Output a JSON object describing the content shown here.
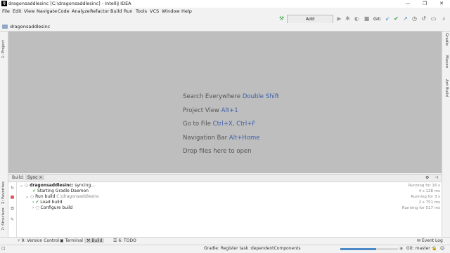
{
  "window": {
    "title": "dragonsaddlesinc [C:\\dragonsaddlesinc] - IntelliJ IDEA",
    "app_icon": "IJ",
    "controls": [
      "—",
      "❐",
      "✕"
    ]
  },
  "menu": [
    "File",
    "Edit",
    "View",
    "Navigate",
    "Code",
    "Analyze",
    "Refactor",
    "Build",
    "Run",
    "Tools",
    "VCS",
    "Window",
    "Help"
  ],
  "toolbar": {
    "add_config_label": "Add Configuration...",
    "git_label": "Git:"
  },
  "nav": {
    "crumb": "dragonsaddlesinc"
  },
  "left_tool_windows": [
    "1: Project",
    "2: Favorites",
    "7: Structure"
  ],
  "right_tool_windows": [
    "Gradle",
    "Maven",
    "Ant Build"
  ],
  "editor_hints": [
    {
      "text": "Search Everywhere ",
      "key": "Double Shift"
    },
    {
      "text": "Project View ",
      "key": "Alt+1"
    },
    {
      "text": "Go to File ",
      "key": "Ctrl+X, Ctrl+F"
    },
    {
      "text": "Navigation Bar ",
      "key": "Alt+Home"
    },
    {
      "text": "Drop files here to open",
      "key": ""
    }
  ],
  "build_panel": {
    "tabs": [
      "Build:",
      "Sync"
    ],
    "rows": [
      {
        "label": "dragonsaddlesinc:",
        "extra": " syncing...",
        "duration": "Running for 16 s"
      },
      {
        "label": "Starting Gradle Daemon",
        "extra": "",
        "duration": "4 s 128 ms"
      },
      {
        "label": "Run build",
        "extra": " C:\\dragonsaddlesinc",
        "duration": "Running for 3 s"
      },
      {
        "label": "Load build",
        "extra": "",
        "duration": "2 s 751 ms"
      },
      {
        "label": "Configure build",
        "extra": "",
        "duration": "Running for 517 ms"
      }
    ]
  },
  "bottom_tabs": [
    "9: Version Control",
    "Terminal",
    "Build",
    "6: TODO",
    "Event Log"
  ],
  "status": {
    "task": "Gradle: Register task :dependentComponents",
    "progress": 0.62,
    "git_branch": "Git: master ÷"
  }
}
